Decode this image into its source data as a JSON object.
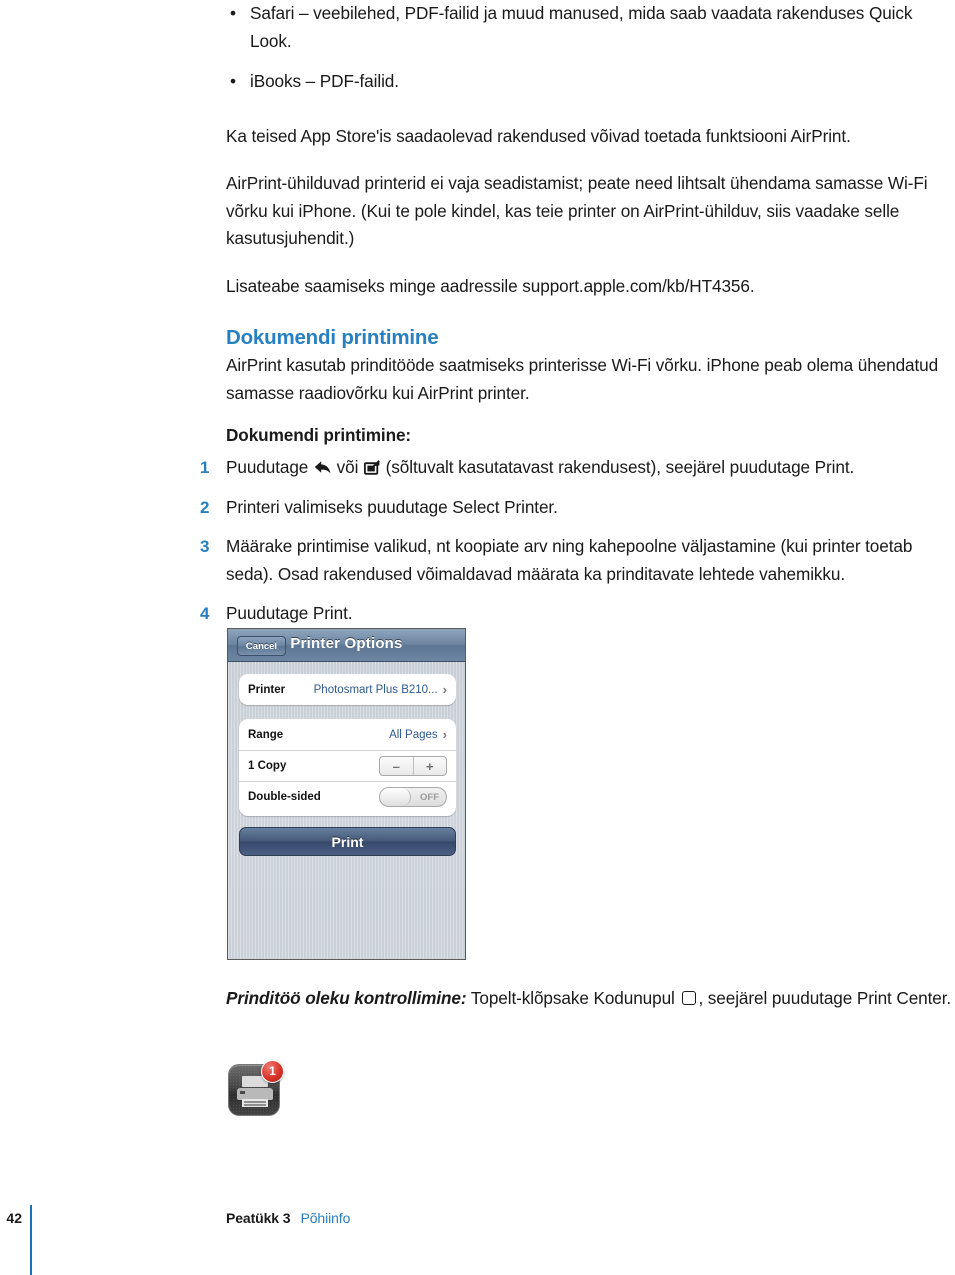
{
  "document": {
    "bullets": [
      {
        "text": "Safari – veebilehed, PDF-failid ja muud manused, mida saab vaadata rakenduses Quick Look."
      },
      {
        "text": "iBooks – PDF-failid."
      }
    ],
    "paragraph_1": "Ka teised App Store'is saadaolevad rakendused võivad toetada funktsiooni AirPrint.",
    "paragraph_2": "AirPrint-ühilduvad printerid ei vaja seadistamist; peate need lihtsalt ühendama samasse Wi-Fi võrku kui iPhone. (Kui te pole kindel, kas teie printer on AirPrint-ühilduv, siis vaadake selle kasutusjuhendit.)",
    "paragraph_3": "Lisateabe saamiseks minge aadressile support.apple.com/kb/HT4356.",
    "section_heading": "Dokumendi printimine",
    "section_intro": "AirPrint kasutab prinditööde saatmiseks printerisse Wi-Fi võrku. iPhone peab olema ühendatud samasse raadiovõrku kui AirPrint printer.",
    "sub_heading": "Dokumendi printimine:",
    "steps": [
      {
        "num": "1",
        "part_a": "Puudutage ",
        "icon_a": "reply-arrow-icon",
        "part_b": " või ",
        "icon_b": "share-export-icon",
        "part_c": " (sõltuvalt kasutatavast rakendusest), seejärel puudutage Print."
      },
      {
        "num": "2",
        "text": "Printeri valimiseks puudutage Select Printer."
      },
      {
        "num": "3",
        "text": "Määrake printimise valikud, nt koopiate arv ning kahepoolne väljastamine (kui printer toetab seda). Osad rakendused võimaldavad määrata ka prinditavate lehtede vahemikku."
      },
      {
        "num": "4",
        "text": "Puudutage Print."
      }
    ],
    "status_note": {
      "lead": "Prinditöö oleku kontrollimine:",
      "part_a": " Topelt-klõpsake Kodunupul ",
      "icon": "home-button-icon",
      "part_b": ", seejärel puudutage Print Center."
    }
  },
  "screenshot": {
    "nav": {
      "cancel_label": "Cancel",
      "title": "Printer Options"
    },
    "rows": [
      {
        "label": "Printer",
        "value": "Photosmart Plus B210...",
        "accessory": "chevron-right-icon"
      },
      {
        "label": "Range",
        "value": "All Pages",
        "accessory": "chevron-right-icon"
      },
      {
        "label": "1 Copy",
        "accessory": "stepper",
        "minus": "–",
        "plus": "+"
      },
      {
        "label": "Double-sided",
        "accessory": "toggle",
        "toggle_state": "OFF"
      }
    ],
    "print_button_label": "Print"
  },
  "print_center_icon": {
    "badge_count": "1",
    "icon_name": "print-center-app-icon"
  },
  "footer": {
    "page_number": "42",
    "chapter": "Peatükk 3",
    "section": "Põhiinfo"
  },
  "colors": {
    "accent_blue": "#2680c2",
    "rule_blue": "#1b72b5",
    "badge_red": "#d9342a"
  }
}
